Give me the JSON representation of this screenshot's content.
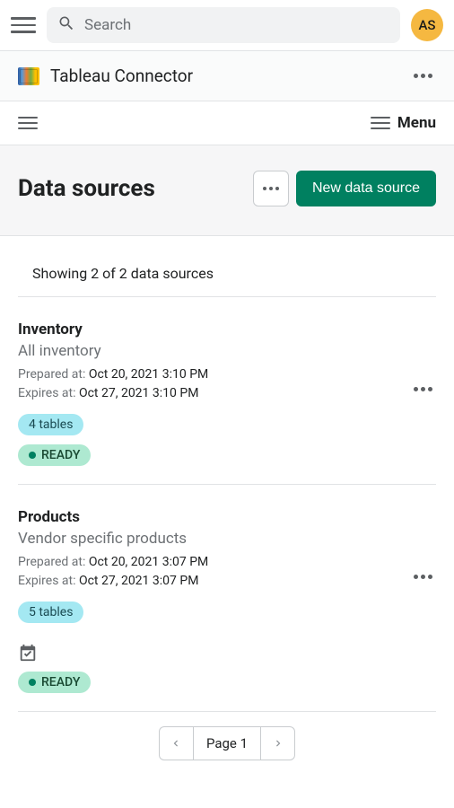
{
  "header": {
    "search_placeholder": "Search",
    "avatar_initials": "AS"
  },
  "connector": {
    "title": "Tableau Connector"
  },
  "secondary_nav": {
    "menu_label": "Menu"
  },
  "page": {
    "title": "Data sources",
    "new_button": "New data source",
    "showing": "Showing 2 of 2 data sources"
  },
  "items": [
    {
      "name": "Inventory",
      "description": "All inventory",
      "prepared_label": "Prepared at: ",
      "prepared_at": "Oct 20, 2021 3:10 PM",
      "expires_label": "Expires at: ",
      "expires_at": "Oct 27, 2021 3:10 PM",
      "tables": "4 tables",
      "status": "READY",
      "has_schedule": false
    },
    {
      "name": "Products",
      "description": "Vendor specific products",
      "prepared_label": "Prepared at: ",
      "prepared_at": "Oct 20, 2021 3:07 PM",
      "expires_label": "Expires at: ",
      "expires_at": "Oct 27, 2021 3:07 PM",
      "tables": "5 tables",
      "status": "READY",
      "has_schedule": true
    }
  ],
  "pagination": {
    "label": "Page 1"
  }
}
